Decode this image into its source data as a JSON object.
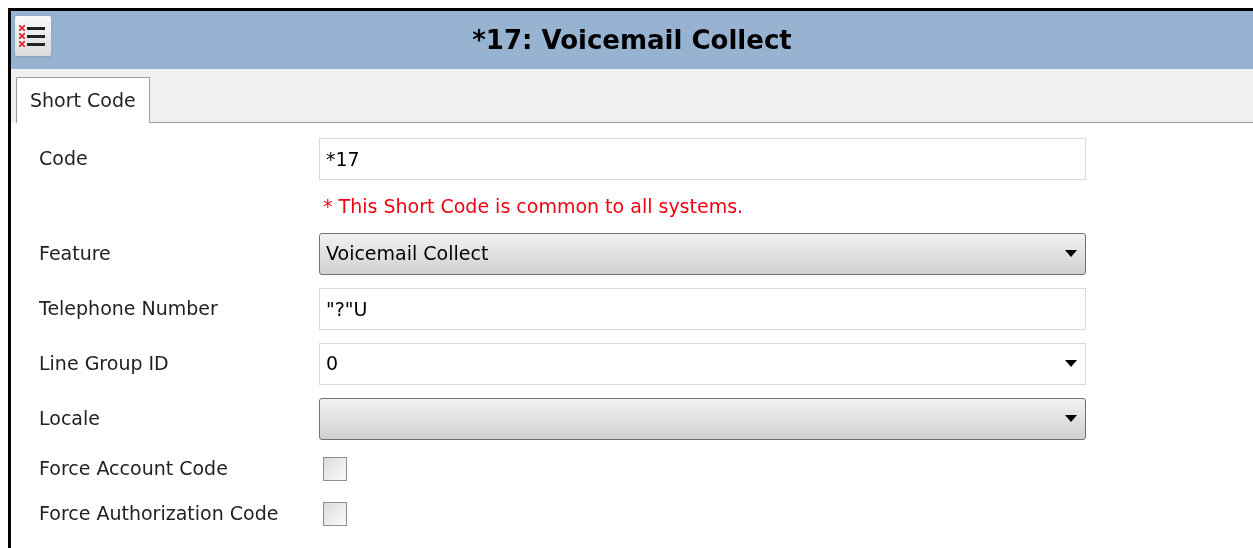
{
  "window": {
    "title": "*17: Voicemail Collect"
  },
  "tabs": [
    {
      "label": "Short Code",
      "selected": true
    }
  ],
  "rows": [
    {
      "kind": "text",
      "label": "Code",
      "value": "*17"
    },
    {
      "kind": "note",
      "text": "* This Short Code is common to all systems."
    },
    {
      "kind": "select",
      "label": "Feature",
      "value": "Voicemail Collect"
    },
    {
      "kind": "text",
      "label": "Telephone Number",
      "value": "\"?\"U"
    },
    {
      "kind": "combo",
      "label": "Line Group ID",
      "value": "0"
    },
    {
      "kind": "select",
      "label": "Locale"
    },
    {
      "kind": "checkbox",
      "label": "Force Account Code",
      "checked": false
    },
    {
      "kind": "checkbox",
      "label": "Force Authorization Code",
      "checked": false
    }
  ]
}
